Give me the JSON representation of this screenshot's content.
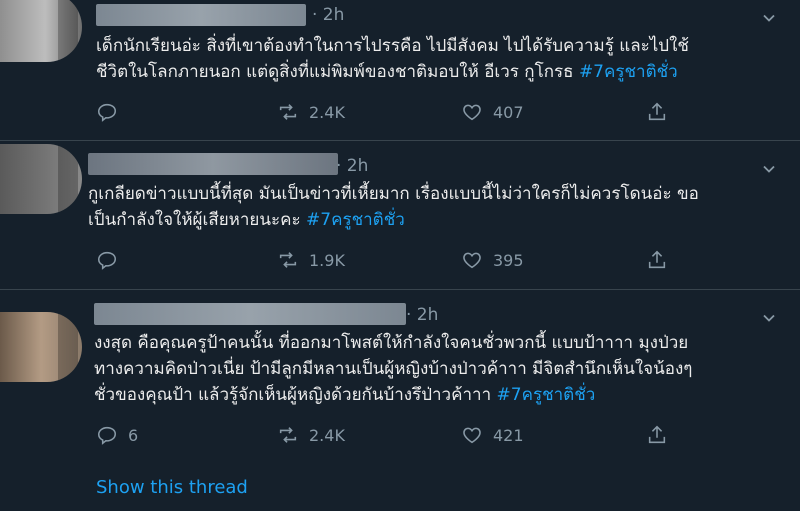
{
  "tweets": [
    {
      "time": "· 2h",
      "lines": [
        "เด็กนักเรียนอ่ะ สิ่งที่เขาต้องทำในการไปรรคือ ไปมีสังคม ไปได้รับความรู้ และไปใช้",
        "ชีวิตในโลกภายนอก แต่ดูสิ่งที่แม่พิมพ์ของชาติมอบให้ อีเวร กูโกรธ"
      ],
      "hashtag": "#7ครูชาติชั่ว",
      "reply_count": "",
      "retweet_count": "2.4K",
      "like_count": "407"
    },
    {
      "time": "· 2h",
      "lines": [
        "กูเกลียดข่าวแบบนี้ที่สุด มันเป็นข่าวที่เหี้ยมาก เรื่องแบบนี้ไม่ว่าใครก็ไม่ควรโดนอ่ะ ขอ",
        "เป็นกำลังใจให้ผู้เสียหายนะคะ"
      ],
      "hashtag": "#7ครูชาติชั่ว",
      "reply_count": "",
      "retweet_count": "1.9K",
      "like_count": "395"
    },
    {
      "time": "· 2h",
      "lines": [
        "งงสุด คือคุณครูป้าคนนั้น ที่ออกมาโพสต์ให้กำลังใจคนชั่วพวกนี้ แบบป้าาาา มุงป่วย",
        "ทางความคิดป่าวเนี่ย ป้ามีลูกมีหลานเป็นผู้หญิงบ้างป่าวค้าาา มีจิตสำนึกเห็นใจน้องๆ",
        "ชั่วของคุณป้า แล้วรู้จักเห็นผู้หญิงด้วยกันบ้างรึป่าวค้าาา"
      ],
      "hashtag": "#7ครูชาติชั่ว",
      "reply_count": "6",
      "retweet_count": "2.4K",
      "like_count": "421"
    }
  ],
  "show_thread": "Show this thread",
  "colors": {
    "background": "#15202b",
    "link": "#1da1f2",
    "muted": "#8899a6",
    "divider": "#38444d"
  }
}
